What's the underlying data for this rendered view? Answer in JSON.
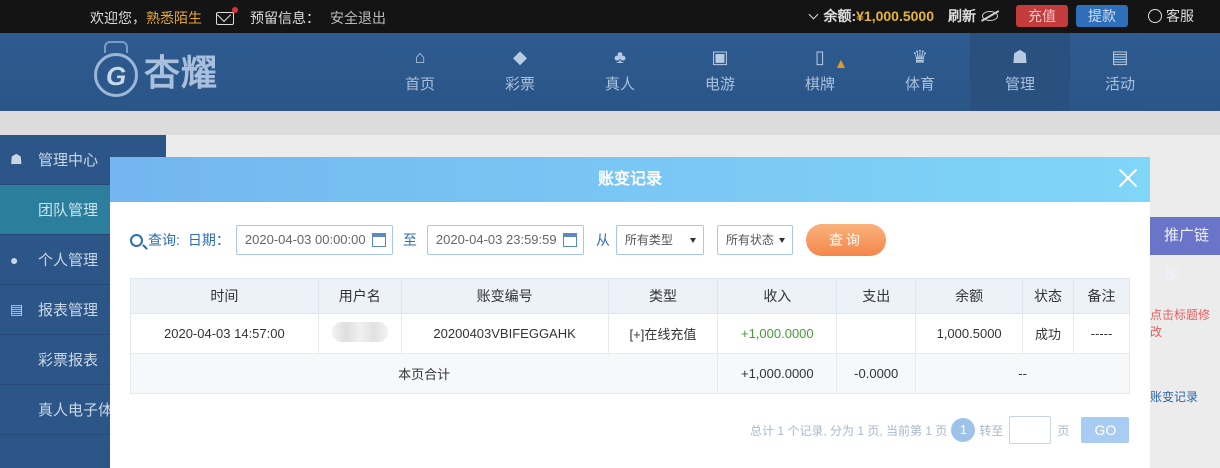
{
  "topbar": {
    "welcome": "欢迎您，",
    "username": "熟悉陌生",
    "reserve_label": "预留信息：",
    "logout": "安全退出",
    "balance_label": "余额:",
    "balance_value": "¥1,000.5000",
    "refresh": "刷新",
    "deposit": "充值",
    "withdraw": "提款",
    "service": "客服"
  },
  "logo": {
    "text": "杏耀",
    "mark": "G"
  },
  "nav": [
    {
      "label": "首页",
      "icon": "home-icon"
    },
    {
      "label": "彩票",
      "icon": "ticket-icon"
    },
    {
      "label": "真人",
      "icon": "live-icon"
    },
    {
      "label": "电游",
      "icon": "game-icon"
    },
    {
      "label": "棋牌",
      "icon": "cards-icon"
    },
    {
      "label": "体育",
      "icon": "trophy-icon"
    },
    {
      "label": "管理",
      "icon": "users-icon"
    },
    {
      "label": "活动",
      "icon": "gift-icon"
    }
  ],
  "sidebar": {
    "items": [
      {
        "label": "管理中心"
      },
      {
        "label": "团队管理"
      },
      {
        "label": "个人管理"
      },
      {
        "label": "报表管理"
      },
      {
        "label": "彩票报表"
      },
      {
        "label": "真人电子体"
      }
    ]
  },
  "peek": {
    "button": "推广链接",
    "red_text": "点击标题修改",
    "blue_link": "账变记录"
  },
  "modal": {
    "title": "账变记录",
    "filters": {
      "query_label": "查询:",
      "date_label": "日期：",
      "start": "2020-04-03 00:00:00",
      "to": "至",
      "end": "2020-04-03 23:59:59",
      "from": "从",
      "type": "所有类型",
      "status": "所有状态",
      "query_button": "查询"
    },
    "columns": [
      "时间",
      "用户名",
      "账变编号",
      "类型",
      "收入",
      "支出",
      "余额",
      "状态",
      "备注"
    ],
    "rows": [
      {
        "time": "2020-04-03 14:57:00",
        "id": "20200403VBIFEGGAHK",
        "type": "[+]在线充值",
        "income": "+1,000.0000",
        "expense": "",
        "balance": "1,000.5000",
        "status": "成功",
        "note": "-----"
      }
    ],
    "summary": {
      "label": "本页合计",
      "income": "+1,000.0000",
      "expense": "-0.0000",
      "rest": "--"
    },
    "pager": {
      "info": "总计 1 个记录, 分为 1 页, 当前第 1 页",
      "page": "1",
      "goto": "转至",
      "page_suffix": "页",
      "go": "GO"
    }
  }
}
